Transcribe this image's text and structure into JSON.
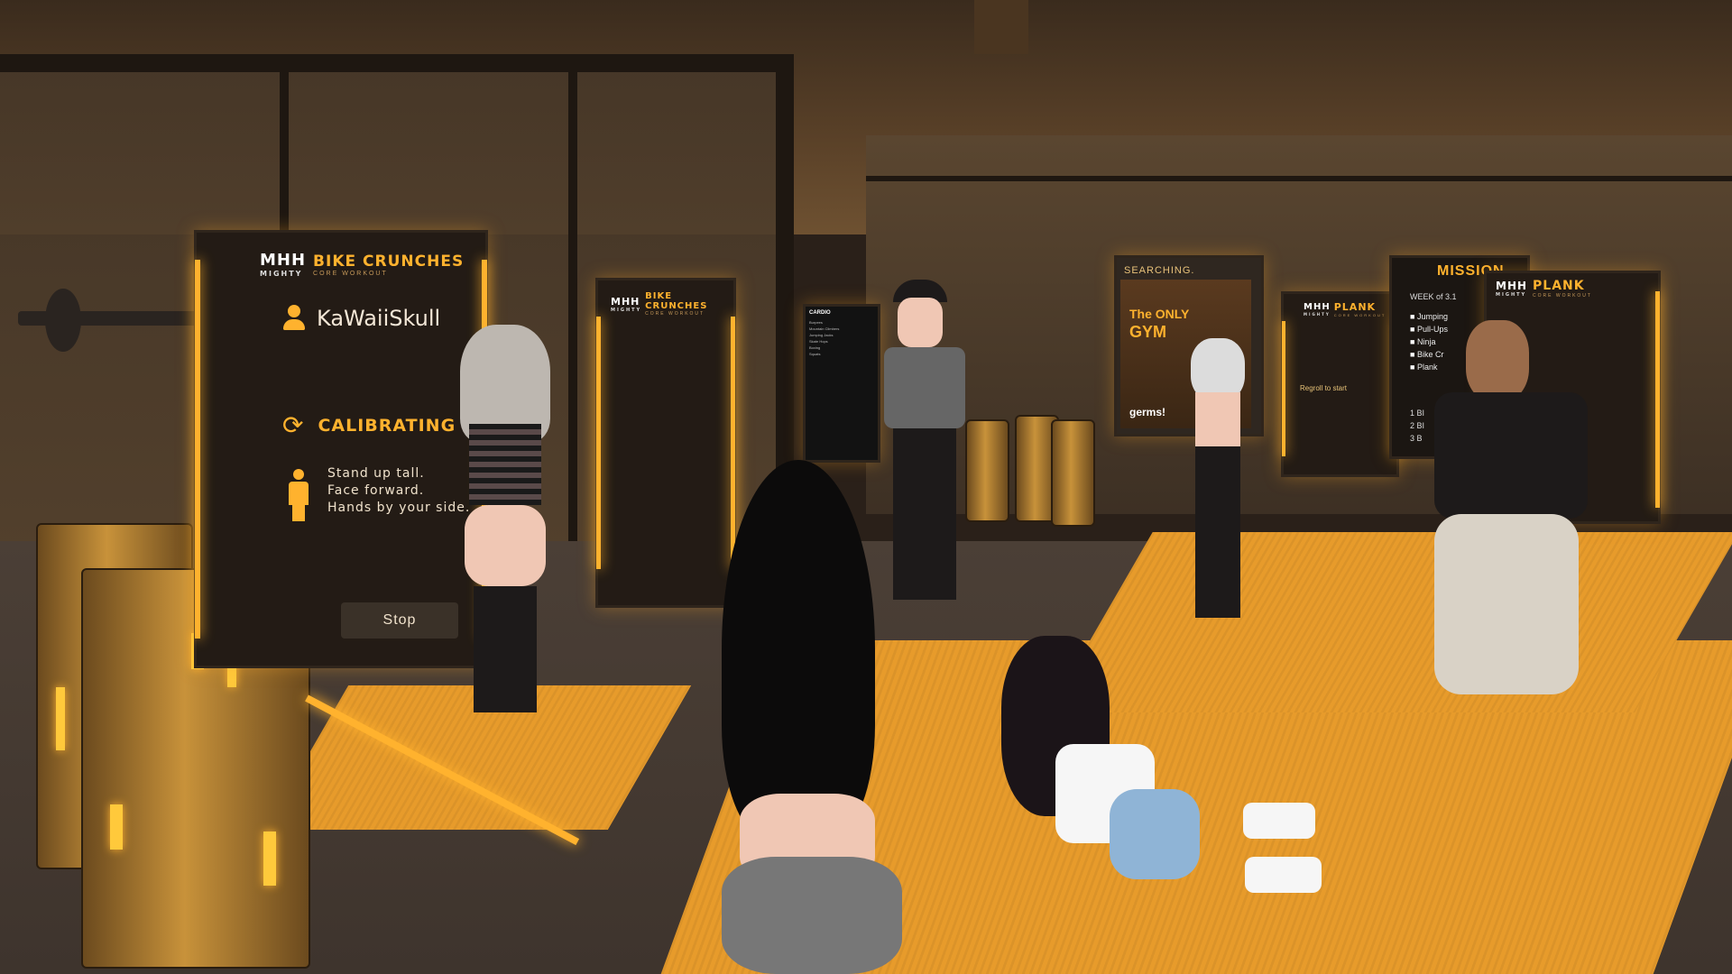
{
  "main_station": {
    "logo": "MHH",
    "logo_sub": "MIGHTY",
    "title": "BIKE CRUNCHES",
    "subtitle": "CORE WORKOUT",
    "username": "KaWaiiSkull",
    "status": "CALIBRATING",
    "instructions": [
      "Stand up tall.",
      "Face forward.",
      "Hands by your side."
    ],
    "stop_label": "Stop"
  },
  "second_station": {
    "logo": "MHH",
    "logo_sub": "MIGHTY",
    "title": "BIKE CRUNCHES",
    "subtitle": "CORE WORKOUT"
  },
  "menu_panel": {
    "title": "CARDIO",
    "items": [
      "Burpees",
      "Mountain Climbers",
      "Jumping Jacks",
      "Skate Hops",
      "Boxing",
      "Squats"
    ]
  },
  "search_panel": {
    "status": "SEARCHING.",
    "poster_line1": "The ONLY",
    "poster_line2": "GYM",
    "poster_tag": "germs!"
  },
  "mission_panel": {
    "title": "MISSION",
    "week": "WEEK of 3.1",
    "items": [
      "Jumping",
      "Pull-Ups",
      "Ninja",
      "Bike Cr",
      "Plank"
    ],
    "rows": [
      "1 BI",
      "2 BI",
      "3 B"
    ]
  },
  "plank_station_1": {
    "logo": "MHH",
    "logo_sub": "MIGHTY",
    "title": "PLANK",
    "subtitle": "CORE WORKOUT",
    "prompt": "Regroll to start"
  },
  "plank_station_2": {
    "logo": "MHH",
    "logo_sub": "MIGHTY",
    "title": "PLANK",
    "subtitle": "CORE WORKOUT"
  },
  "colors": {
    "accent": "#ffb22e",
    "mat": "#e79b2b",
    "panel_bg": "#231b15"
  }
}
